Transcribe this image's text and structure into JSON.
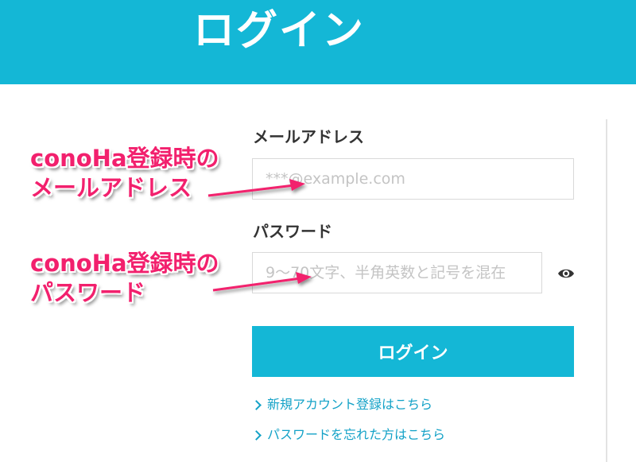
{
  "header": {
    "title": "ログイン"
  },
  "form": {
    "email_label": "メールアドレス",
    "email_placeholder": "***@example.com",
    "password_label": "パスワード",
    "password_placeholder": "9～70文字、半角英数と記号を混在",
    "login_button": "ログイン"
  },
  "links": {
    "register": "新規アカウント登録はこちら",
    "forgot_password": "パスワードを忘れた方はこちら"
  },
  "annotations": {
    "email_line1": "conoHa登録時の",
    "email_line2": "メールアドレス",
    "password_line1": "conoHa登録時の",
    "password_line2": "パスワード"
  },
  "colors": {
    "brand": "#14b7d6",
    "link": "#14a2c7",
    "annotation": "#f2206d"
  },
  "icons": {
    "show_password": "eye-icon",
    "link_chevron": "chevron-right-icon"
  }
}
